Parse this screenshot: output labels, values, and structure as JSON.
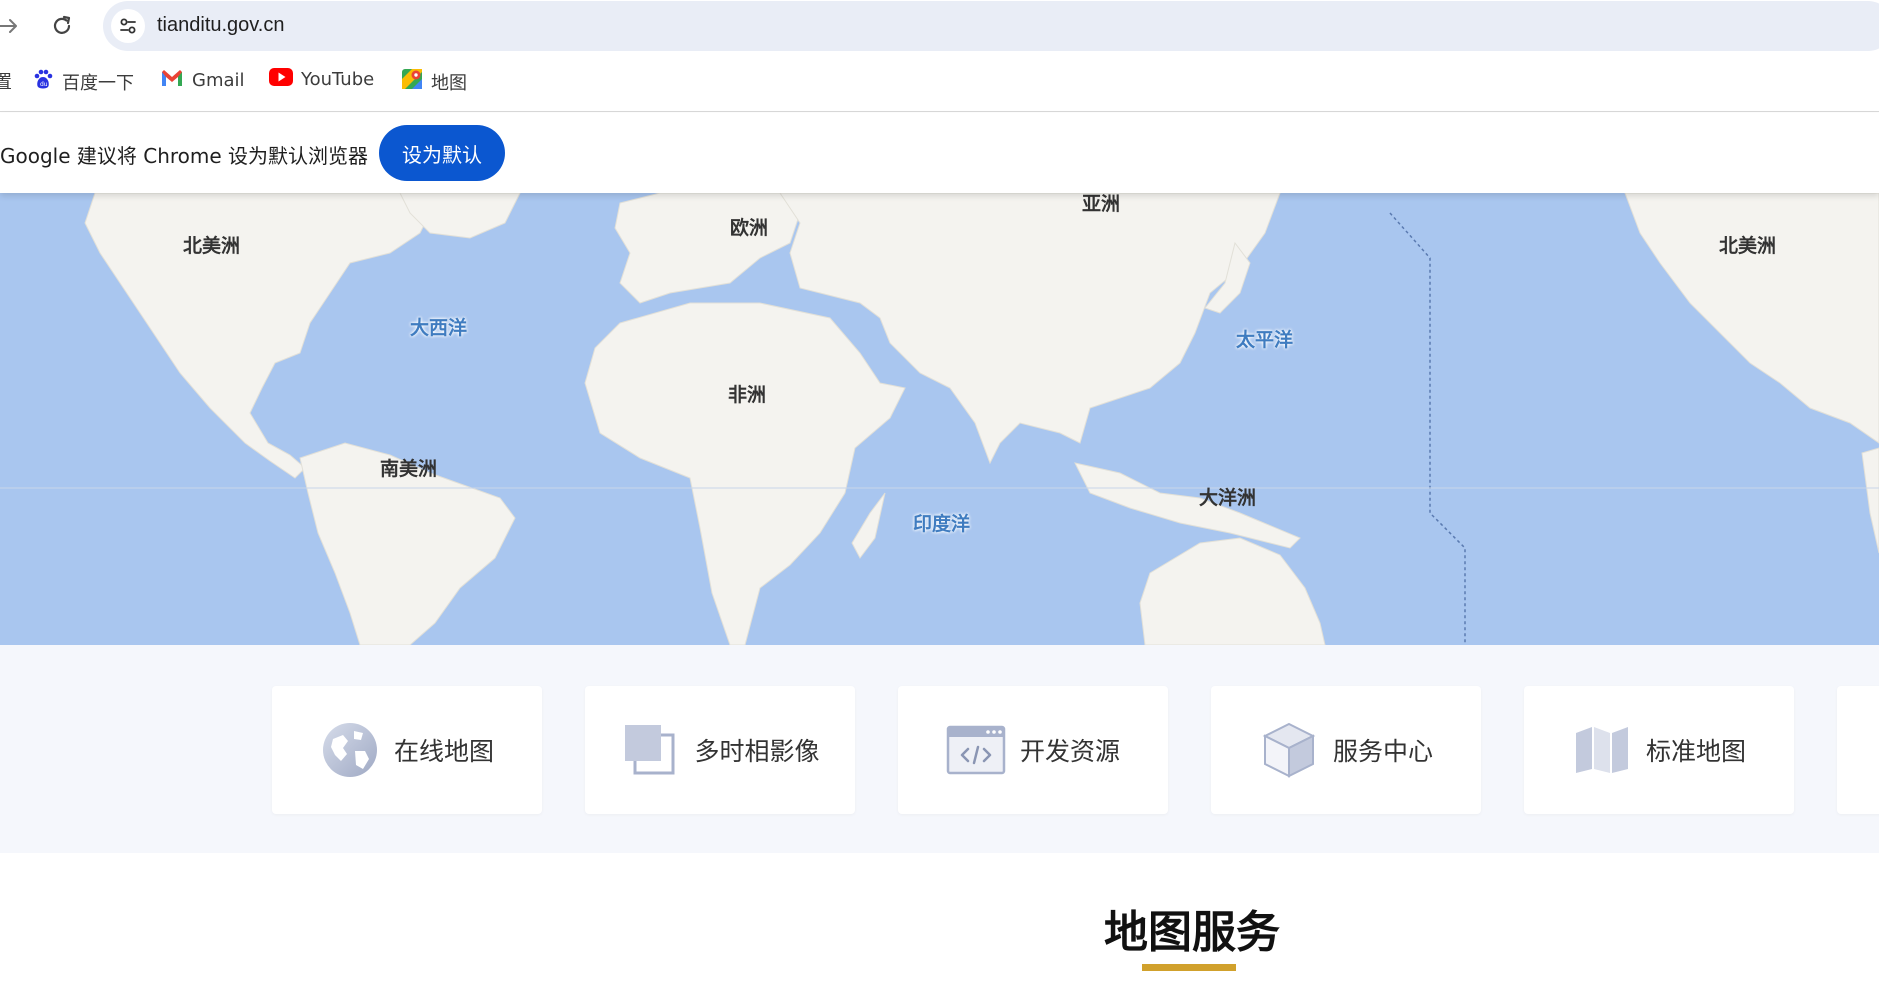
{
  "browser": {
    "url": "tianditu.gov.cn",
    "bookmarks": [
      {
        "label": "置",
        "icon": "settings-fragment"
      },
      {
        "label": "百度一下",
        "icon": "baidu-icon"
      },
      {
        "label": "Gmail",
        "icon": "gmail-icon"
      },
      {
        "label": "YouTube",
        "icon": "youtube-icon"
      },
      {
        "label": "地图",
        "icon": "maps-icon"
      }
    ],
    "infobar": {
      "message": "Google 建议将 Chrome 设为默认浏览器",
      "button_label": "设为默认"
    }
  },
  "map": {
    "continents": [
      "北美洲",
      "欧洲",
      "亚洲",
      "北美洲",
      "非洲",
      "南美洲",
      "大洋洲"
    ],
    "oceans": [
      "大西洋",
      "太平洋",
      "印度洋"
    ],
    "colors": {
      "ocean": "#a9c6ef",
      "land": "#f4f3ef"
    }
  },
  "quick_nav": [
    {
      "label": "在线地图",
      "icon": "globe-icon"
    },
    {
      "label": "多时相影像",
      "icon": "layers-icon"
    },
    {
      "label": "开发资源",
      "icon": "code-window-icon"
    },
    {
      "label": "服务中心",
      "icon": "cube-icon"
    },
    {
      "label": "标准地图",
      "icon": "folded-map-icon"
    }
  ],
  "section": {
    "title": "地图服务",
    "accent": "#d1a12c"
  }
}
